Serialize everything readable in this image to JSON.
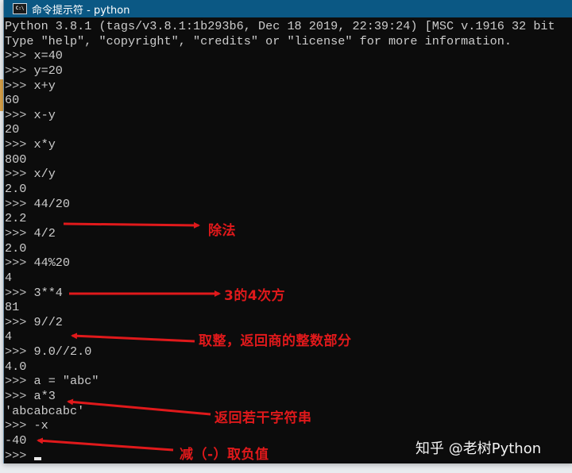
{
  "window": {
    "title": "命令提示符 - python",
    "icon": "cmd-icon",
    "icon_label": "C:\\",
    "colors": {
      "titlebar": "#0b5884",
      "console_bg": "#0c0c0c",
      "console_text": "#cccccc",
      "annotation": "#e0191b"
    }
  },
  "console": {
    "lines": [
      {
        "type": "output",
        "text": "Python 3.8.1 (tags/v3.8.1:1b293b6, Dec 18 2019, 22:39:24) [MSC v.1916 32 bit"
      },
      {
        "type": "output",
        "text": "Type \"help\", \"copyright\", \"credits\" or \"license\" for more information."
      },
      {
        "type": "input",
        "prompt": ">>> ",
        "text": "x=40"
      },
      {
        "type": "input",
        "prompt": ">>> ",
        "text": "y=20"
      },
      {
        "type": "input",
        "prompt": ">>> ",
        "text": "x+y"
      },
      {
        "type": "output",
        "text": "60"
      },
      {
        "type": "input",
        "prompt": ">>> ",
        "text": "x-y"
      },
      {
        "type": "output",
        "text": "20"
      },
      {
        "type": "input",
        "prompt": ">>> ",
        "text": "x*y"
      },
      {
        "type": "output",
        "text": "800"
      },
      {
        "type": "input",
        "prompt": ">>> ",
        "text": "x/y"
      },
      {
        "type": "output",
        "text": "2.0"
      },
      {
        "type": "input",
        "prompt": ">>> ",
        "text": "44/20"
      },
      {
        "type": "output",
        "text": "2.2"
      },
      {
        "type": "input",
        "prompt": ">>> ",
        "text": "4/2"
      },
      {
        "type": "output",
        "text": "2.0"
      },
      {
        "type": "input",
        "prompt": ">>> ",
        "text": "44%20"
      },
      {
        "type": "output",
        "text": "4"
      },
      {
        "type": "input",
        "prompt": ">>> ",
        "text": "3**4"
      },
      {
        "type": "output",
        "text": "81"
      },
      {
        "type": "input",
        "prompt": ">>> ",
        "text": "9//2"
      },
      {
        "type": "output",
        "text": "4"
      },
      {
        "type": "input",
        "prompt": ">>> ",
        "text": "9.0//2.0"
      },
      {
        "type": "output",
        "text": "4.0"
      },
      {
        "type": "input",
        "prompt": ">>> ",
        "text": "a = \"abc\""
      },
      {
        "type": "input",
        "prompt": ">>> ",
        "text": "a*3"
      },
      {
        "type": "output",
        "text": "'abcabcabc'"
      },
      {
        "type": "input",
        "prompt": ">>> ",
        "text": "-x"
      },
      {
        "type": "output",
        "text": "-40"
      },
      {
        "type": "input",
        "prompt": ">>> ",
        "text": "",
        "cursor": true
      }
    ]
  },
  "annotations": [
    {
      "id": "division",
      "text": "除法"
    },
    {
      "id": "power",
      "text": "3的4次方"
    },
    {
      "id": "floor-division",
      "text": "取整，返回商的整数部分"
    },
    {
      "id": "string-repeat",
      "text": "返回若干字符串"
    },
    {
      "id": "negation",
      "text": "减（-）取负值"
    }
  ],
  "watermark": "知乎 @老树Python"
}
